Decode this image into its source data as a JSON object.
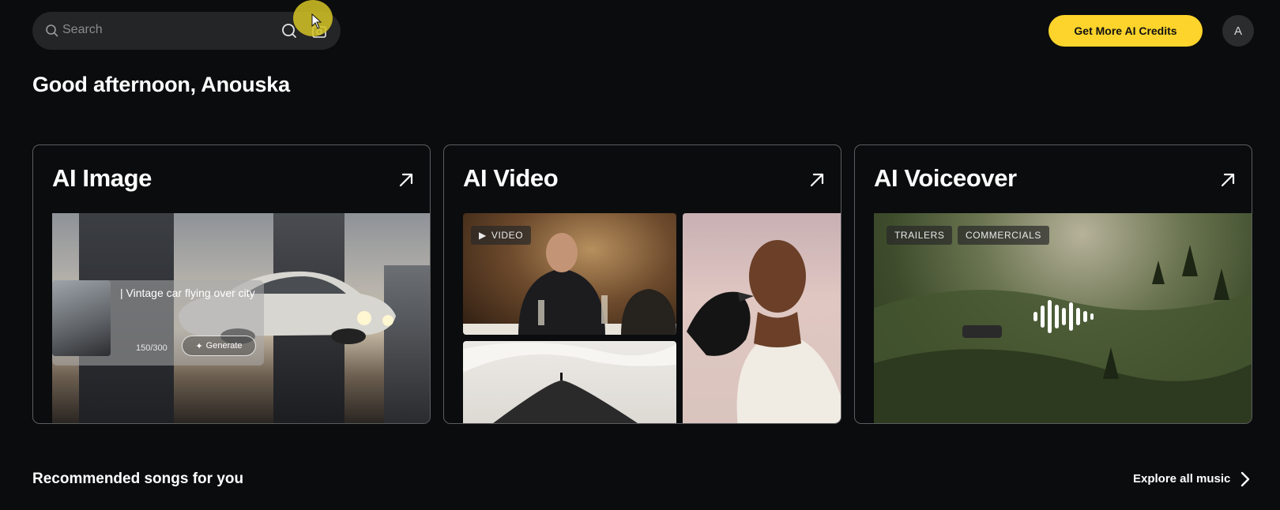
{
  "header": {
    "search": {
      "placeholder": "Search"
    },
    "cta_label": "Get More AI Credits",
    "avatar_initial": "A"
  },
  "greeting": "Good afternoon, Anouska",
  "cards": [
    {
      "title": "AI Image",
      "prompt": "| Vintage car flying over city",
      "counter": "150/300",
      "generate_label": "Generate"
    },
    {
      "title": "AI Video",
      "chip": "VIDEO"
    },
    {
      "title": "AI Voiceover",
      "chips": [
        "TRAILERS",
        "COMMERCIALS"
      ]
    }
  ],
  "recommended": {
    "title": "Recommended songs for you",
    "explore_label": "Explore all music"
  },
  "colors": {
    "accent": "#fcd42b",
    "background": "#0b0c0d"
  }
}
